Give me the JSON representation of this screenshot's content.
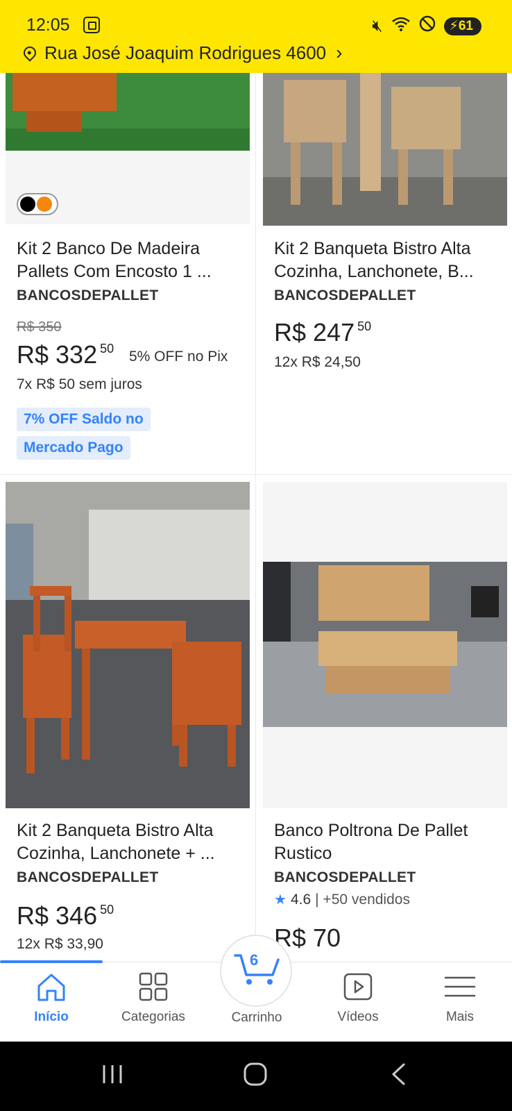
{
  "status": {
    "time": "12:05",
    "battery": "61",
    "icons": [
      "mute-icon",
      "wifi-icon",
      "do-not-disturb-icon"
    ]
  },
  "header": {
    "address": "Rua José Joaquim Rodrigues 4600",
    "accent": "#FFE600"
  },
  "products": [
    {
      "title": "Kit 2 Banco De Madeira Pallets Com Encosto 1 ...",
      "seller": "BANCOSDEPALLET",
      "old_price": "R$ 350",
      "price": "R$ 332",
      "cents": "50",
      "discount": "5% OFF no Pix",
      "installments": "7x R$ 50 sem juros",
      "badge_line1": "7% OFF Saldo no",
      "badge_line2": "Mercado Pago",
      "swatch_colors": [
        "#000000",
        "#F5870F"
      ]
    },
    {
      "title": "Kit 2 Banqueta Bistro Alta Cozinha, Lanchonete, B...",
      "seller": "BANCOSDEPALLET",
      "price": "R$ 247",
      "cents": "50",
      "installments": "12x R$ 24,50"
    },
    {
      "title": "Kit 2 Banqueta Bistro Alta Cozinha, Lanchonete + ...",
      "seller": "BANCOSDEPALLET",
      "price": "R$ 346",
      "cents": "50",
      "installments": "12x R$ 33,90"
    },
    {
      "title": "Banco Poltrona De Pallet Rustico",
      "seller": "BANCOSDEPALLET",
      "rating": "4.6",
      "sold": "| +50 vendidos",
      "price": "R$ 70"
    }
  ],
  "nav": {
    "home": "Início",
    "categories": "Categorias",
    "cart": "Carrinho",
    "cart_count": "6",
    "videos": "Vídeos",
    "more": "Mais",
    "active_color": "#3483FA"
  }
}
